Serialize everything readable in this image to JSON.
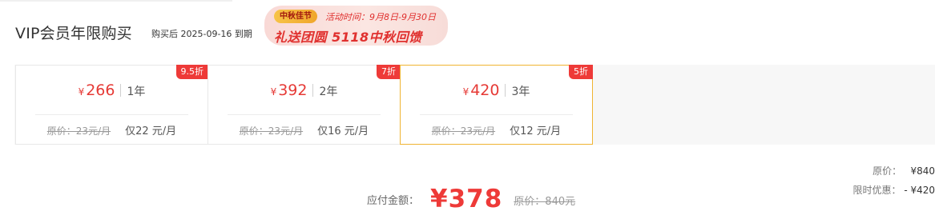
{
  "header": {
    "title": "VIP会员年限购买",
    "expire_note": "购买后 2025-09-16 到期"
  },
  "promo": {
    "tag": "中秋佳节",
    "period": "活动时间：9月8日-9月30日",
    "headline": "礼送团圆 5118中秋回馈"
  },
  "plans": [
    {
      "badge": "9.5折",
      "currency": "¥",
      "price": "266",
      "duration": "1年",
      "original": "原价：23元/月",
      "monthly": "仅22 元/月",
      "selected": false
    },
    {
      "badge": "7折",
      "currency": "¥",
      "price": "392",
      "duration": "2年",
      "original": "原价：23元/月",
      "monthly": "仅16 元/月",
      "selected": false
    },
    {
      "badge": "5折",
      "currency": "¥",
      "price": "420",
      "duration": "3年",
      "original": "原价：23元/月",
      "monthly": "仅12 元/月",
      "selected": true
    }
  ],
  "summary": {
    "original_label": "原价：",
    "original_value": "¥840",
    "discount_label": "限时优惠：",
    "discount_value": "- ¥420"
  },
  "payment": {
    "label": "应付金额：",
    "amount": "¥378",
    "original": "原价：840元"
  },
  "colors": {
    "accent_red": "#ee3a38",
    "selected_border": "#f0b432"
  }
}
